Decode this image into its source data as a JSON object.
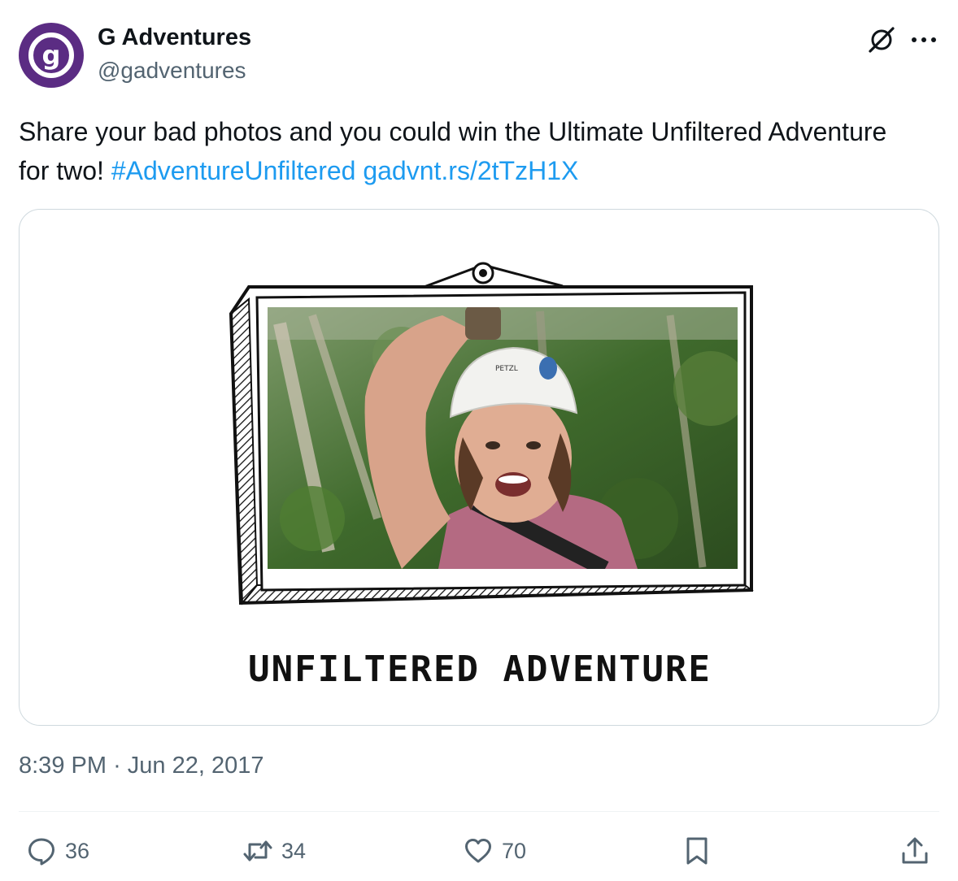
{
  "author": {
    "name": "G Adventures",
    "handle": "@gadventures",
    "avatar_letter": "g",
    "avatar_color": "#5b2c83"
  },
  "tweet": {
    "text": "Share your bad photos and you could win the Ultimate Unfiltered Adventure for two!",
    "hashtag": "#AdventureUnfiltered",
    "link": "gadvnt.rs/2tTzH1X"
  },
  "media": {
    "caption": "UNFILTERED ADVENTURE",
    "helmet_text": "PETZL"
  },
  "meta": {
    "time": "8:39 PM",
    "separator": "·",
    "date": "Jun 22, 2017"
  },
  "actions": {
    "replies": "36",
    "retweets": "34",
    "likes": "70"
  },
  "colors": {
    "text": "#0f1419",
    "secondary": "#536471",
    "link": "#1d9bf0",
    "border": "#cfd9de"
  }
}
